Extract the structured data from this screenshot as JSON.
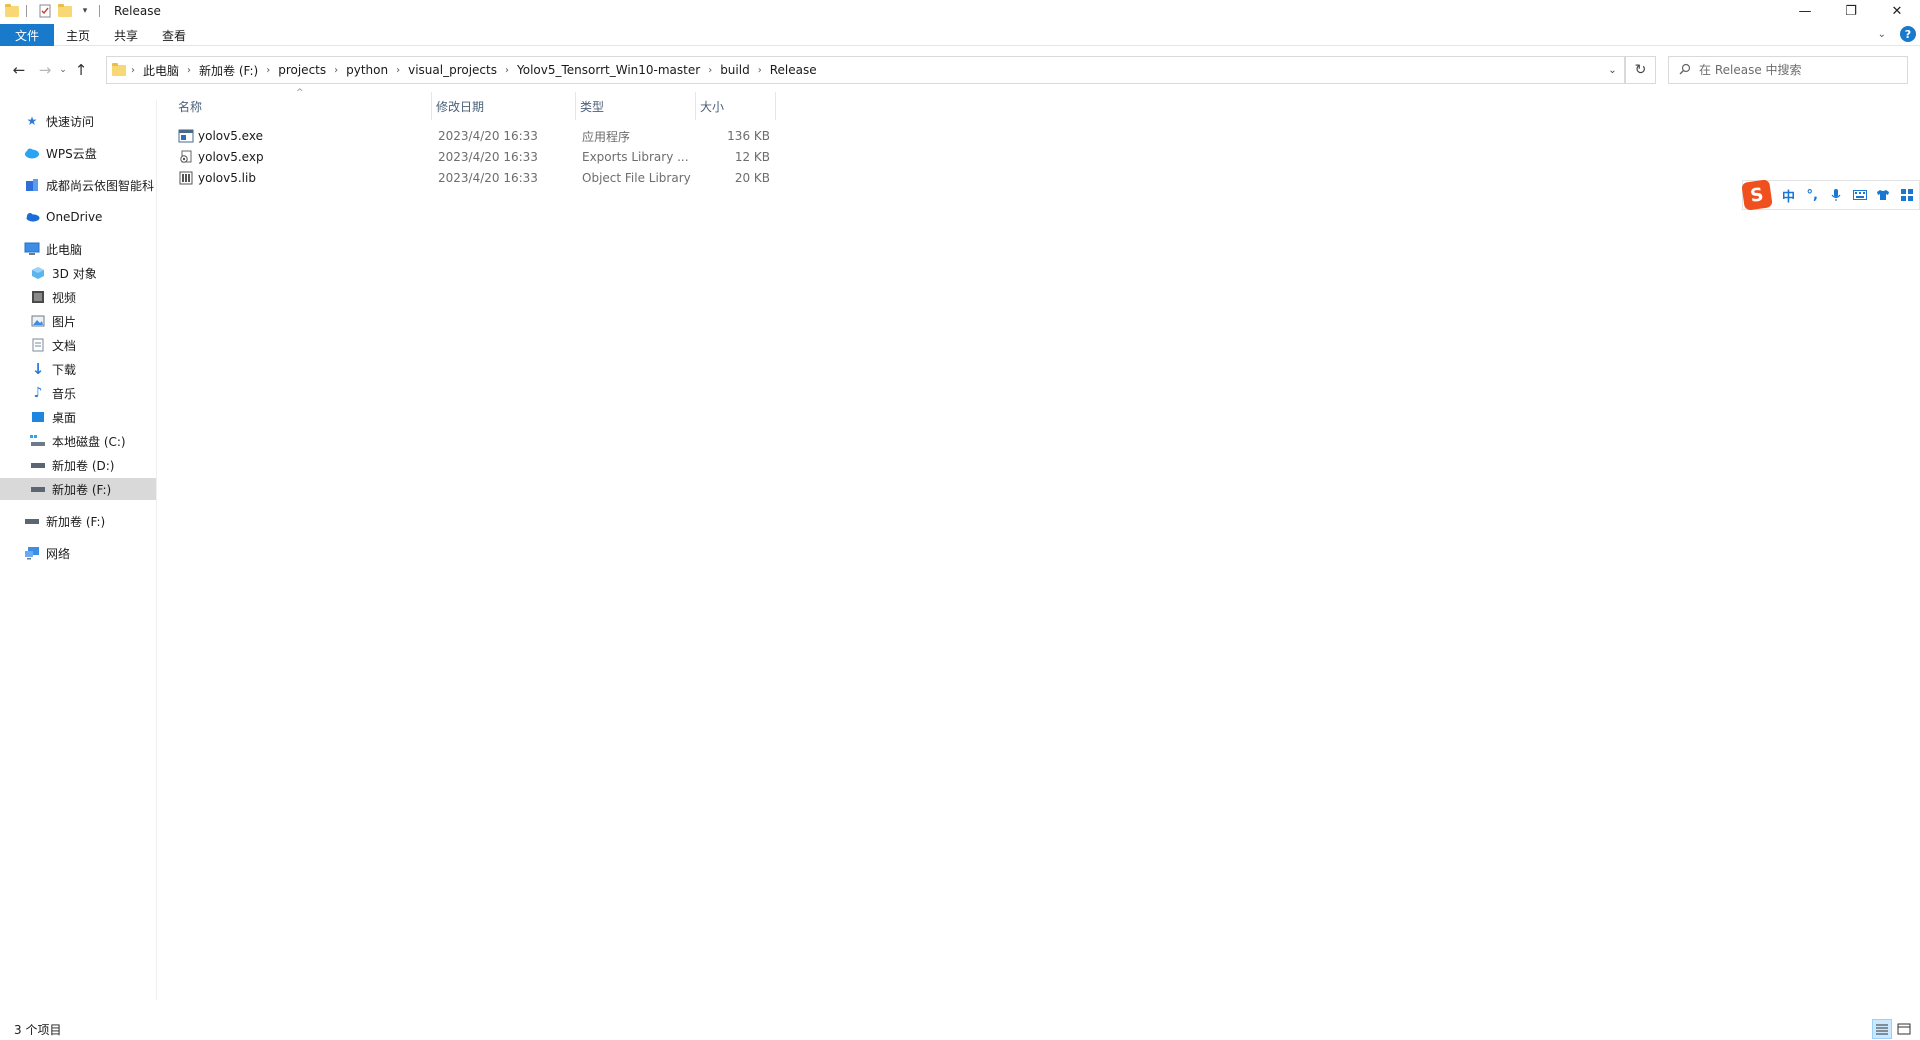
{
  "window": {
    "title": "Release",
    "controls": {
      "minimize": "—",
      "maximize": "❐",
      "close": "✕"
    }
  },
  "ribbon": {
    "tabs": [
      "文件",
      "主页",
      "共享",
      "查看"
    ]
  },
  "address": {
    "crumbs": [
      "此电脑",
      "新加卷 (F:)",
      "projects",
      "python",
      "visual_projects",
      "Yolov5_Tensorrt_Win10-master",
      "build",
      "Release"
    ]
  },
  "search": {
    "placeholder": "在 Release 中搜索"
  },
  "sidebar": {
    "items": [
      {
        "label": "快速访问",
        "icon": "star-icon"
      },
      {
        "label": "WPS云盘",
        "icon": "cloud-icon"
      },
      {
        "label": "成都尚云依图智能科",
        "icon": "org-icon"
      },
      {
        "label": "OneDrive",
        "icon": "onedrive-icon"
      },
      {
        "label": "此电脑",
        "icon": "computer-icon"
      },
      {
        "label": "3D 对象",
        "icon": "cube-icon"
      },
      {
        "label": "视频",
        "icon": "video-icon"
      },
      {
        "label": "图片",
        "icon": "picture-icon"
      },
      {
        "label": "文档",
        "icon": "document-icon"
      },
      {
        "label": "下载",
        "icon": "download-icon"
      },
      {
        "label": "音乐",
        "icon": "music-icon"
      },
      {
        "label": "桌面",
        "icon": "desktop-icon"
      },
      {
        "label": "本地磁盘 (C:)",
        "icon": "system-drive-icon"
      },
      {
        "label": "新加卷 (D:)",
        "icon": "drive-icon"
      },
      {
        "label": "新加卷 (F:)",
        "icon": "drive-icon"
      },
      {
        "label": "新加卷 (F:)",
        "icon": "drive-icon"
      },
      {
        "label": "网络",
        "icon": "network-icon"
      }
    ]
  },
  "columns": {
    "name": "名称",
    "date": "修改日期",
    "type": "类型",
    "size": "大小"
  },
  "files": [
    {
      "name": "yolov5.exe",
      "date": "2023/4/20 16:33",
      "type": "应用程序",
      "size": "136 KB",
      "icon": "exe-icon"
    },
    {
      "name": "yolov5.exp",
      "date": "2023/4/20 16:33",
      "type": "Exports Library ...",
      "size": "12 KB",
      "icon": "exp-file-icon"
    },
    {
      "name": "yolov5.lib",
      "date": "2023/4/20 16:33",
      "type": "Object File Library",
      "size": "20 KB",
      "icon": "lib-file-icon"
    }
  ],
  "ime": {
    "logo": "S",
    "mode": "中",
    "punct": "°,",
    "mic": "🎤",
    "keyboard": "⌨",
    "skin": "👕",
    "menu": "⊞"
  },
  "status": {
    "count": "3 个项目"
  },
  "colors": {
    "accent": "#1979ca",
    "selected": "#d9d9d9",
    "ime_logo": "#f0501e"
  }
}
